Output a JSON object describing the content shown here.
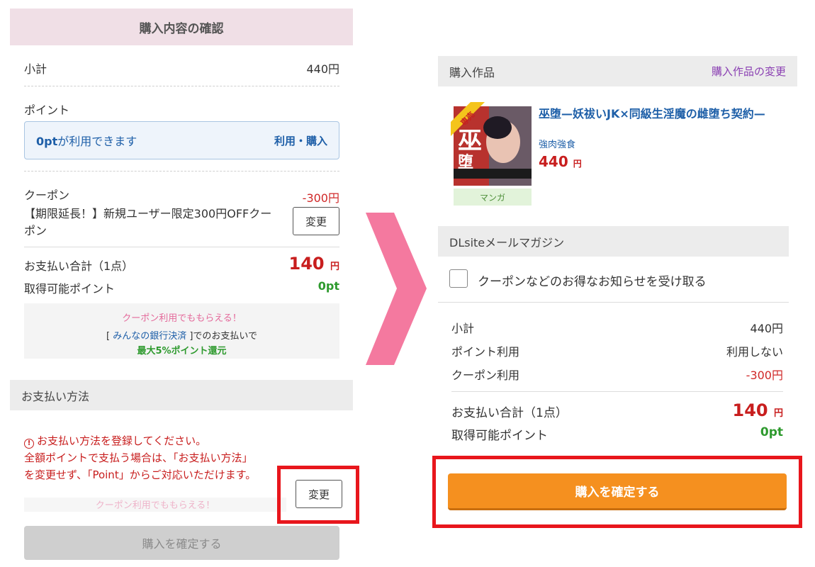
{
  "left": {
    "title": "購入内容の確認",
    "subtotal_label": "小計",
    "subtotal_value": "440円",
    "point_label": "ポイント",
    "point_avail_bold": "0pt",
    "point_avail_rest": "が利用できます",
    "point_use_link": "利用・購入",
    "coupon_label": "クーポン",
    "coupon_value": "-300円",
    "coupon_desc": "【期限延長！】新規ユーザー限定300円OFFクーポン",
    "coupon_change": "変更",
    "total_label": "お支払い合計（1点）",
    "total_value": "140",
    "total_unit": "円",
    "earn_label": "取得可能ポイント",
    "earn_value": "0pt",
    "promo_line1": "クーポン利用でももらえる！",
    "promo_bracket_open": "[ ",
    "promo_link": "みんなの銀行決済",
    "promo_bracket_close": " ]でのお支払いで",
    "promo_line3": "最大5%ポイント還元",
    "payment_section": "お支払い方法",
    "warn_icon": "!",
    "warn_line1": "お支払い方法を登録してください。",
    "warn_line2": "全額ポイントで支払う場合は、「お支払い方法」",
    "warn_line3": "を変更せず、「Point」からご対応いただけます。",
    "payment_change": "変更",
    "promo_faded": "クーポン利用でももらえる！",
    "confirm_disabled": "購入を確定する"
  },
  "right": {
    "works_section": "購入作品",
    "works_change_link": "購入作品の変更",
    "ribbon": "専売",
    "work_title": "巫堕—妖祓いJK×同級生淫魔の雌堕ち契約—",
    "circle": "強肉強食",
    "work_price": "440",
    "work_price_unit": "円",
    "category_tag": "マンガ",
    "mail_section": "DLsiteメールマガジン",
    "newsletter_label": "クーポンなどのお得なお知らせを受け取る",
    "subtotal_label": "小計",
    "subtotal_value": "440円",
    "point_use_label": "ポイント利用",
    "point_use_value": "利用しない",
    "coupon_use_label": "クーポン利用",
    "coupon_use_value": "-300円",
    "total_label": "お支払い合計（1点）",
    "total_value": "140",
    "total_unit": "円",
    "earn_label": "取得可能ポイント",
    "earn_value": "0pt",
    "confirm_button": "購入を確定する"
  },
  "colors": {
    "highlight": "#e8161c",
    "arrow": "#f4799f",
    "confirm": "#f5901f",
    "price": "#c81e1e",
    "point_green": "#2e9a2e",
    "link_purple": "#8a3fb2"
  },
  "icons": [
    "warning-circle-icon",
    "right-arrow-icon",
    "checkbox-icon"
  ]
}
